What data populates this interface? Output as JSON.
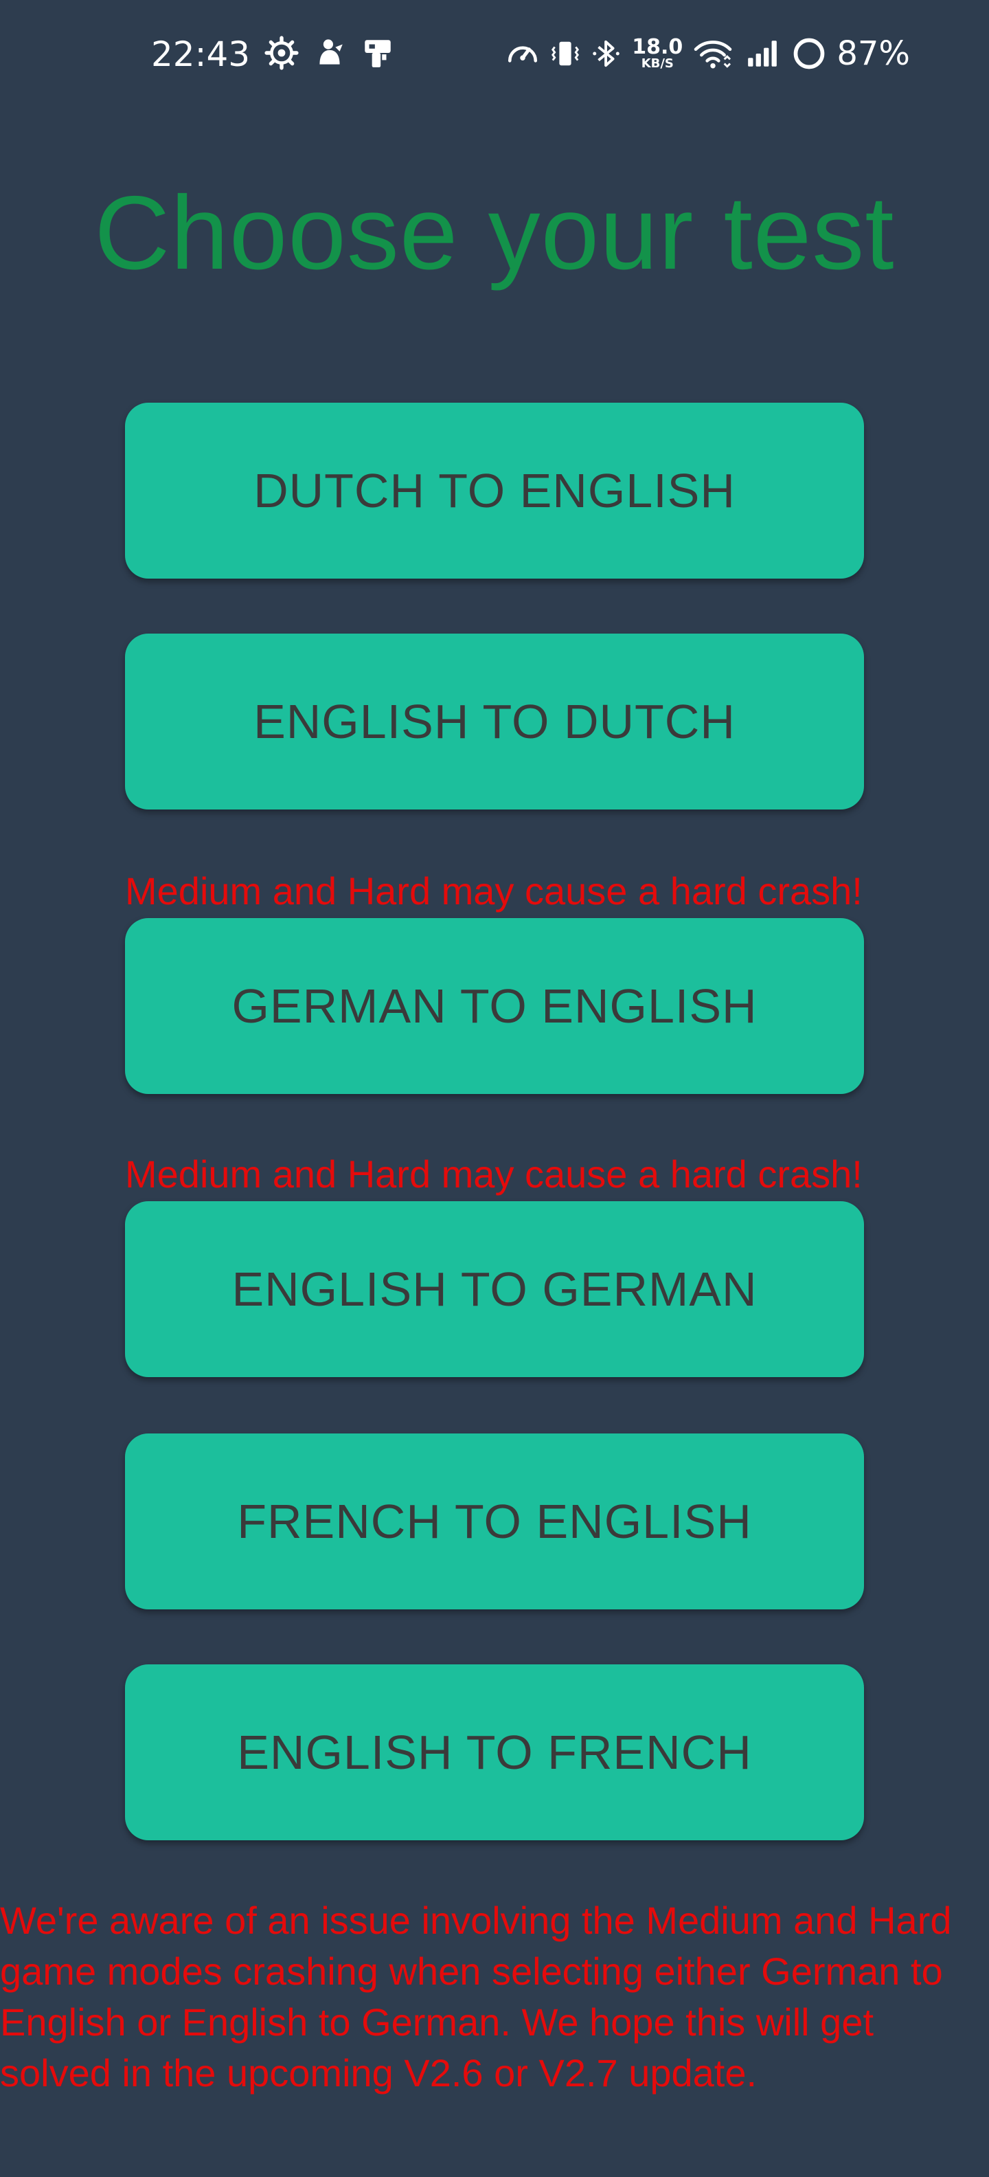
{
  "status_bar": {
    "time": "22:43",
    "net_speed_value": "18.0",
    "net_speed_unit": "KB/S",
    "battery_percent": "87%",
    "left_icons": [
      "settings-gear-icon",
      "app-notification-icon",
      "device-notification-icon"
    ],
    "right_icons": [
      "speedometer-icon",
      "vibrate-icon",
      "bluetooth-icon",
      "wifi-icon",
      "cellular-signal-icon",
      "battery-ring-icon"
    ]
  },
  "page": {
    "title": "Choose your test"
  },
  "tests": [
    {
      "label": "DUTCH TO ENGLISH"
    },
    {
      "label": "ENGLISH TO DUTCH"
    },
    {
      "label": "GERMAN TO ENGLISH"
    },
    {
      "label": "ENGLISH TO GERMAN"
    },
    {
      "label": "FRENCH TO ENGLISH"
    },
    {
      "label": "ENGLISH TO FRENCH"
    }
  ],
  "warnings": {
    "german_to_english": "Medium and Hard may cause a hard crash!",
    "english_to_german": "Medium and Hard may cause a hard crash!"
  },
  "notice": "We're aware of an issue involving the Medium and Hard game modes crashing when selecting either German to English or English to German. We hope this will get solved in the upcoming V2.6 or V2.7 update.",
  "colors": {
    "background": "#2e3d4f",
    "title": "#13924a",
    "button": "#1cbf9c",
    "button_text": "#3a3a3a",
    "warning": "#e50b0b"
  }
}
